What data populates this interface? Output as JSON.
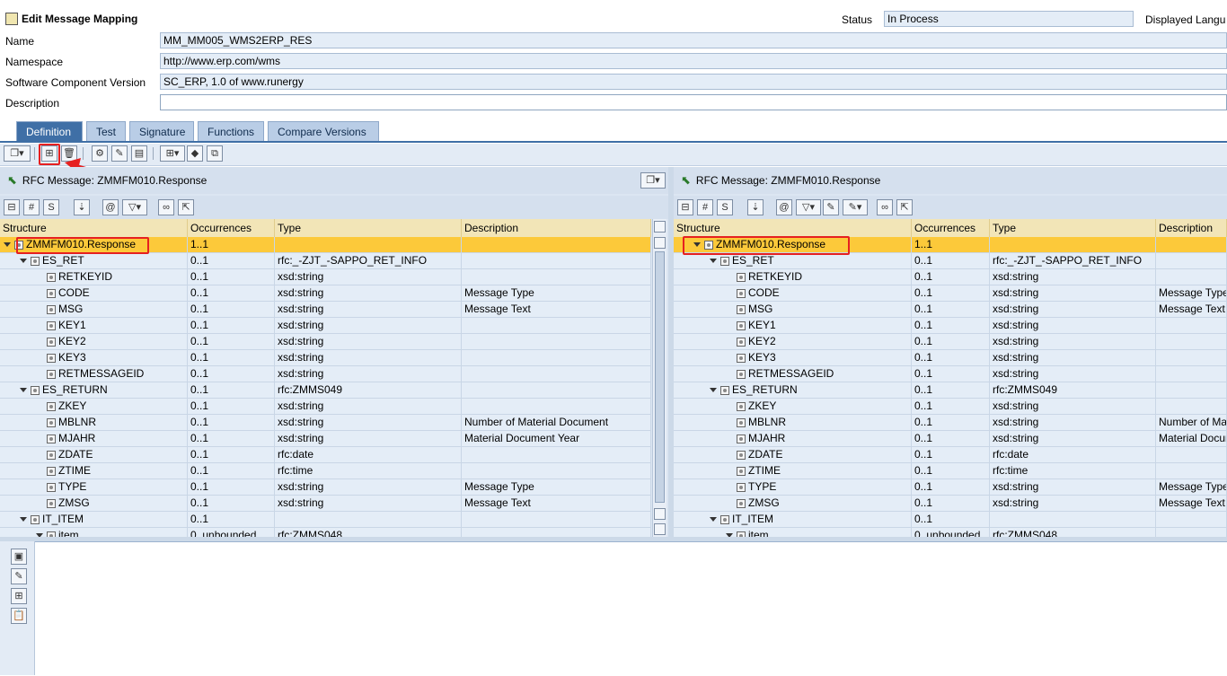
{
  "header": {
    "title": "Edit Message Mapping",
    "status_label": "Status",
    "status_value": "In Process",
    "displayed_label": "Displayed Langu",
    "fields": [
      {
        "label": "Name",
        "value": "MM_MM005_WMS2ERP_RES"
      },
      {
        "label": "Namespace",
        "value": "http://www.erp.com/wms"
      },
      {
        "label": "Software Component Version",
        "value": "SC_ERP, 1.0 of www.runergy"
      },
      {
        "label": "Description",
        "value": ""
      }
    ]
  },
  "tabs": [
    {
      "label": "Definition",
      "active": true
    },
    {
      "label": "Test"
    },
    {
      "label": "Signature"
    },
    {
      "label": "Functions"
    },
    {
      "label": "Compare Versions"
    }
  ],
  "columns": {
    "structure": "Structure",
    "occurrences": "Occurrences",
    "type": "Type",
    "description": "Description"
  },
  "left_panel": {
    "title": "RFC Message: ZMMFM010.Response"
  },
  "right_panel": {
    "title": "RFC Message: ZMMFM010.Response"
  },
  "rows": [
    {
      "level": 0,
      "expand": true,
      "name": "ZMMFM010.Response",
      "occ": "1..1",
      "type": "",
      "desc": "",
      "selected": true
    },
    {
      "level": 1,
      "expand": true,
      "name": "ES_RET",
      "occ": "0..1",
      "type": "rfc:_-ZJT_-SAPPO_RET_INFO",
      "desc": ""
    },
    {
      "level": 2,
      "expand": false,
      "name": "RETKEYID",
      "occ": "0..1",
      "type": "xsd:string",
      "desc": ""
    },
    {
      "level": 2,
      "expand": false,
      "name": "CODE",
      "occ": "0..1",
      "type": "xsd:string",
      "desc": "Message Type"
    },
    {
      "level": 2,
      "expand": false,
      "name": "MSG",
      "occ": "0..1",
      "type": "xsd:string",
      "desc": "Message Text"
    },
    {
      "level": 2,
      "expand": false,
      "name": "KEY1",
      "occ": "0..1",
      "type": "xsd:string",
      "desc": ""
    },
    {
      "level": 2,
      "expand": false,
      "name": "KEY2",
      "occ": "0..1",
      "type": "xsd:string",
      "desc": ""
    },
    {
      "level": 2,
      "expand": false,
      "name": "KEY3",
      "occ": "0..1",
      "type": "xsd:string",
      "desc": ""
    },
    {
      "level": 2,
      "expand": false,
      "name": "RETMESSAGEID",
      "occ": "0..1",
      "type": "xsd:string",
      "desc": ""
    },
    {
      "level": 1,
      "expand": true,
      "name": "ES_RETURN",
      "occ": "0..1",
      "type": "rfc:ZMMS049",
      "desc": ""
    },
    {
      "level": 2,
      "expand": false,
      "name": "ZKEY",
      "occ": "0..1",
      "type": "xsd:string",
      "desc": ""
    },
    {
      "level": 2,
      "expand": false,
      "name": "MBLNR",
      "occ": "0..1",
      "type": "xsd:string",
      "desc": "Number of Material Document"
    },
    {
      "level": 2,
      "expand": false,
      "name": "MJAHR",
      "occ": "0..1",
      "type": "xsd:string",
      "desc": "Material Document Year"
    },
    {
      "level": 2,
      "expand": false,
      "name": "ZDATE",
      "occ": "0..1",
      "type": "rfc:date",
      "desc": ""
    },
    {
      "level": 2,
      "expand": false,
      "name": "ZTIME",
      "occ": "0..1",
      "type": "rfc:time",
      "desc": ""
    },
    {
      "level": 2,
      "expand": false,
      "name": "TYPE",
      "occ": "0..1",
      "type": "xsd:string",
      "desc": "Message Type"
    },
    {
      "level": 2,
      "expand": false,
      "name": "ZMSG",
      "occ": "0..1",
      "type": "xsd:string",
      "desc": "Message Text"
    },
    {
      "level": 1,
      "expand": true,
      "name": "IT_ITEM",
      "occ": "0..1",
      "type": "",
      "desc": ""
    },
    {
      "level": 2,
      "expand": true,
      "name": "item",
      "occ": "0..unbounded",
      "type": "rfc:ZMMS048",
      "desc": ""
    }
  ],
  "colors": {
    "accent": "#3f6fa6",
    "selected_row": "#fcc93a",
    "highlight": "#e62020"
  }
}
